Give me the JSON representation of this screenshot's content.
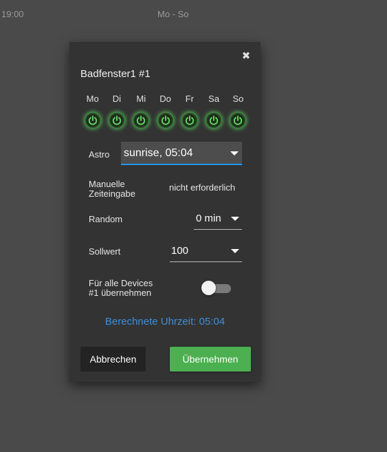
{
  "background": {
    "time_text": "19:00",
    "days_text": "Mo - So"
  },
  "dialog": {
    "title": "Badfenster1 #1",
    "close_symbol": "✖",
    "days": [
      "Mo",
      "Di",
      "Mi",
      "Do",
      "Fr",
      "Sa",
      "So"
    ],
    "day_icon": "power-icon",
    "day_active_color": "#4caf50",
    "astro": {
      "label": "Astro",
      "value": "sunrise, 05:04"
    },
    "manual_time": {
      "label": "Manuelle\nZeiteingabe",
      "value": "nicht erforderlich"
    },
    "random": {
      "label": "Random",
      "value": "0 min"
    },
    "target": {
      "label": "Sollwert",
      "value": "100"
    },
    "apply_all": {
      "label": "Für alle Devices\n#1 übernehmen",
      "enabled": false
    },
    "calculated_time": "Berechnete Uhrzeit: 05:04",
    "cancel_label": "Abbrechen",
    "ok_label": "Übernehmen",
    "accent_color": "#2196f3",
    "ok_color": "#4caf50"
  }
}
